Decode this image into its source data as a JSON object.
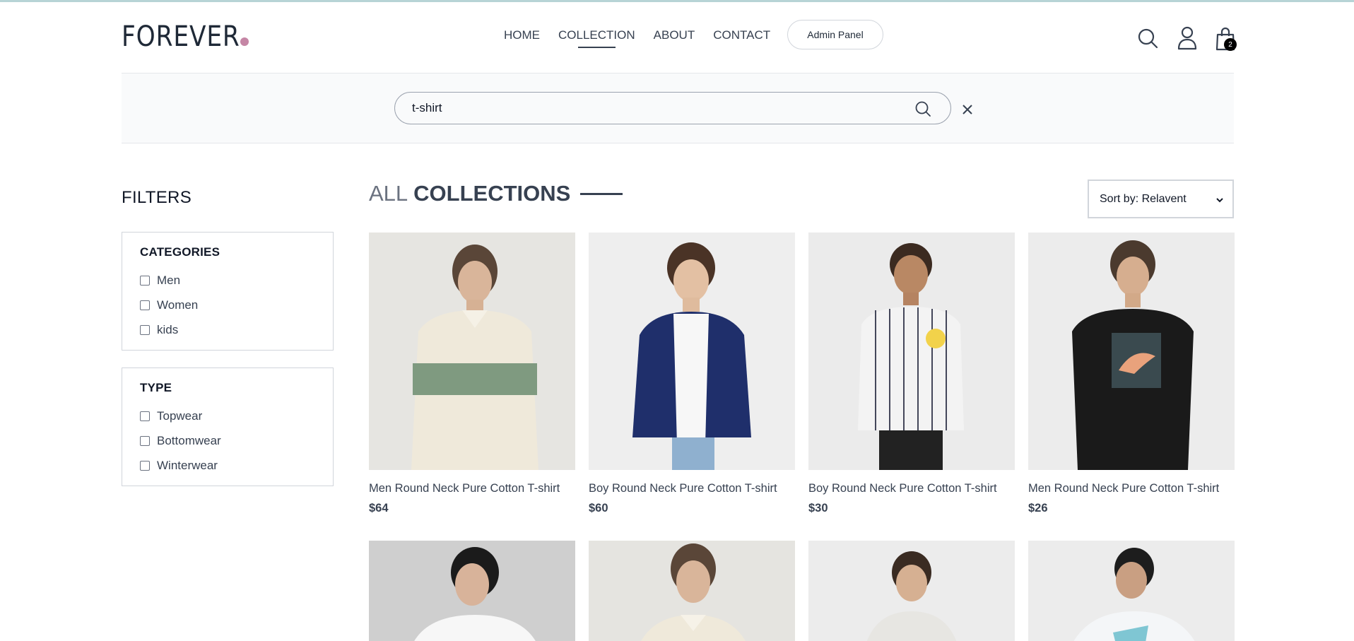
{
  "brand": {
    "logo_text": "FOREVER",
    "accent": "#c586a5"
  },
  "nav": {
    "items": [
      {
        "label": "HOME"
      },
      {
        "label": "COLLECTION",
        "active": true
      },
      {
        "label": "ABOUT"
      },
      {
        "label": "CONTACT"
      }
    ],
    "admin_label": "Admin Panel"
  },
  "header_icons": {
    "search": "search-icon",
    "profile": "user-icon",
    "cart": "shopping-bag-icon",
    "cart_count": "2"
  },
  "search": {
    "value": "t-shirt",
    "placeholder": "Search"
  },
  "filters": {
    "title": "FILTERS",
    "categories": {
      "heading": "CATEGORIES",
      "options": [
        "Men",
        "Women",
        "kids"
      ]
    },
    "type": {
      "heading": "TYPE",
      "options": [
        "Topwear",
        "Bottomwear",
        "Winterwear"
      ]
    }
  },
  "collection": {
    "title_light": "ALL",
    "title_bold": "COLLECTIONS"
  },
  "sort": {
    "label": "Sort by: Relavent"
  },
  "products": [
    {
      "name": "Men Round Neck Pure Cotton T-shirt",
      "price": "$64"
    },
    {
      "name": "Boy Round Neck Pure Cotton T-shirt",
      "price": "$60"
    },
    {
      "name": "Boy Round Neck Pure Cotton T-shirt",
      "price": "$30"
    },
    {
      "name": "Men Round Neck Pure Cotton T-shirt",
      "price": "$26"
    }
  ]
}
